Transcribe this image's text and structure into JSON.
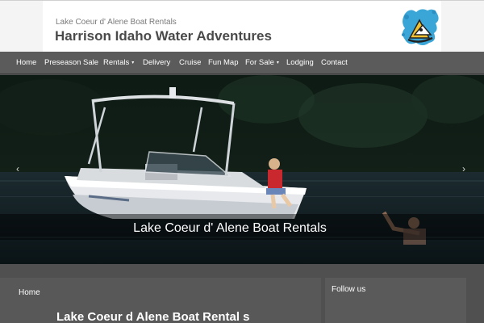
{
  "header": {
    "tagline": "Lake Coeur d' Alene Boat Rentals",
    "site_title": "Harrison Idaho Water Adventures",
    "logo_icon": "jetski-logo-icon"
  },
  "nav": {
    "items": [
      {
        "label": "Home"
      },
      {
        "label": "Preseason Sale"
      },
      {
        "label": "Rentals",
        "has_dropdown": true
      },
      {
        "label": "Delivery"
      },
      {
        "label": "Cruise"
      },
      {
        "label": "Fun Map"
      },
      {
        "label": "For Sale",
        "has_dropdown": true
      },
      {
        "label": "Lodging"
      },
      {
        "label": "Contact"
      }
    ],
    "caret": "▾"
  },
  "slider": {
    "caption": "Lake Coeur d' Alene Boat Rentals",
    "prev_arrow": "‹",
    "next_arrow": "›"
  },
  "content": {
    "breadcrumb": "Home",
    "page_title": "Lake Coeur d Alene Boat Rental s"
  },
  "sidebar": {
    "widget_title": "Follow us"
  },
  "colors": {
    "nav_bg": "#5b5b5b",
    "content_bg": "#505050",
    "title_text": "#4a4a4a"
  }
}
